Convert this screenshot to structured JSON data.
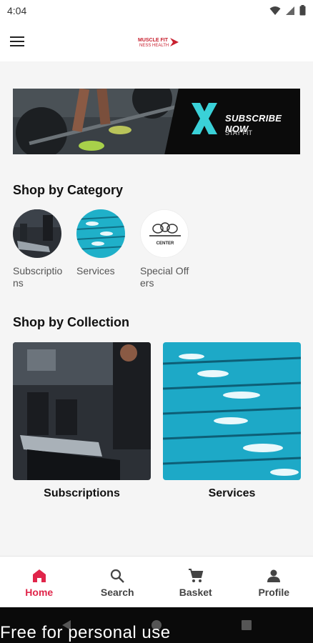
{
  "status_bar": {
    "time": "4:04"
  },
  "app_bar": {
    "logo_text": "MUSCLE FITNESS HEALTH"
  },
  "banner": {
    "title": "SUBSCRIBE NOW",
    "subtitle": "STAY FIT"
  },
  "category_section": {
    "title": "Shop by Category",
    "items": [
      {
        "label": "Subscriptions"
      },
      {
        "label": "Services"
      },
      {
        "label": "Special Offers",
        "image_text": "CENTER"
      }
    ]
  },
  "collection_section": {
    "title": "Shop by Collection",
    "items": [
      {
        "label": "Subscriptions"
      },
      {
        "label": "Services"
      }
    ]
  },
  "bottom_nav": {
    "items": [
      {
        "label": "Home",
        "icon": "home-icon",
        "active": true
      },
      {
        "label": "Search",
        "icon": "search-icon",
        "active": false
      },
      {
        "label": "Basket",
        "icon": "cart-icon",
        "active": false
      },
      {
        "label": "Profile",
        "icon": "person-icon",
        "active": false
      }
    ]
  },
  "watermark": "Free for personal use",
  "colors": {
    "accent": "#e0254a",
    "banner_x": "#3ad1d8"
  }
}
